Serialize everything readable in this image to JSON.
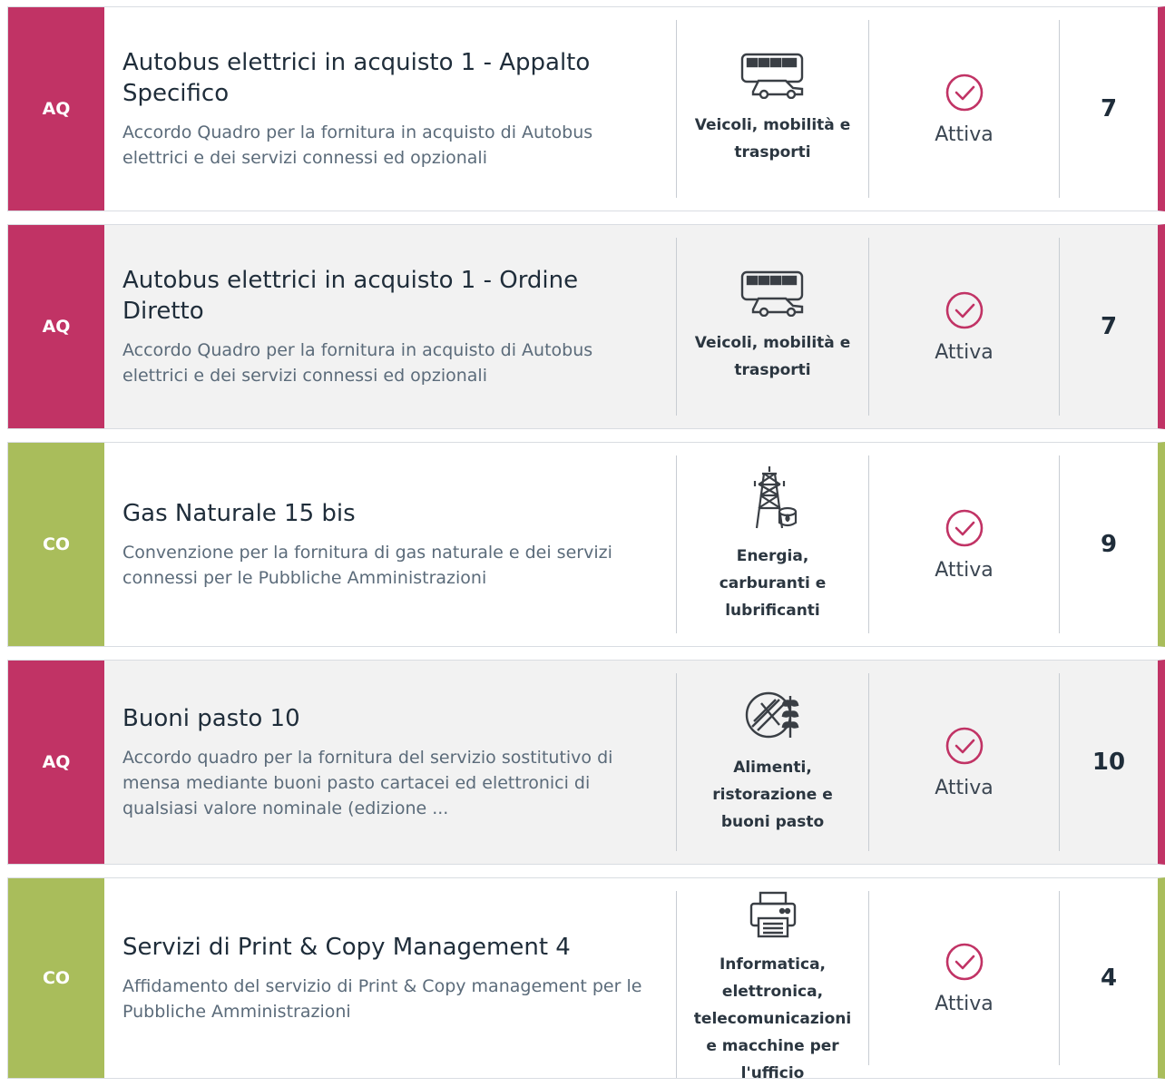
{
  "colors": {
    "aq": "#c13365",
    "co": "#a9bd5b",
    "check": "#c13365"
  },
  "items": [
    {
      "type": "AQ",
      "title": "Autobus elettrici in acquisto 1 - Appalto Specifico",
      "description": "Accordo Quadro per la fornitura in acquisto di Autobus elettrici e dei servizi connessi ed opzionali",
      "category_icon": "bus-car-icon",
      "category": "Veicoli, mobilità e trasporti",
      "status": "Attiva",
      "count": "7"
    },
    {
      "type": "AQ",
      "title": "Autobus elettrici in acquisto 1 - Ordine Diretto",
      "description": "Accordo Quadro per la fornitura in acquisto di Autobus elettrici e dei servizi connessi ed opzionali",
      "category_icon": "bus-car-icon",
      "category": "Veicoli, mobilità e trasporti",
      "status": "Attiva",
      "count": "7"
    },
    {
      "type": "CO",
      "title": "Gas Naturale 15 bis",
      "description": "Convenzione per la fornitura di gas naturale e dei servizi connessi per le Pubbliche Amministrazioni",
      "category_icon": "power-pylon-icon",
      "category": "Energia, carburanti e lubrificanti",
      "status": "Attiva",
      "count": "9"
    },
    {
      "type": "AQ",
      "title": "Buoni pasto 10",
      "description": "Accordo quadro per la fornitura del servizio sostitutivo di mensa mediante buoni pasto cartacei ed elettronici di qualsiasi valore nominale (edizione ...",
      "category_icon": "food-wheat-icon",
      "category": "Alimenti, ristorazione e buoni pasto",
      "status": "Attiva",
      "count": "10"
    },
    {
      "type": "CO",
      "title": "Servizi di Print & Copy Management 4",
      "description": "Affidamento del servizio di Print & Copy management per le Pubbliche Amministrazioni",
      "category_icon": "printer-icon",
      "category": "Informatica, elettronica, telecomunicazioni e macchine per l'ufficio",
      "status": "Attiva",
      "count": "4"
    }
  ]
}
